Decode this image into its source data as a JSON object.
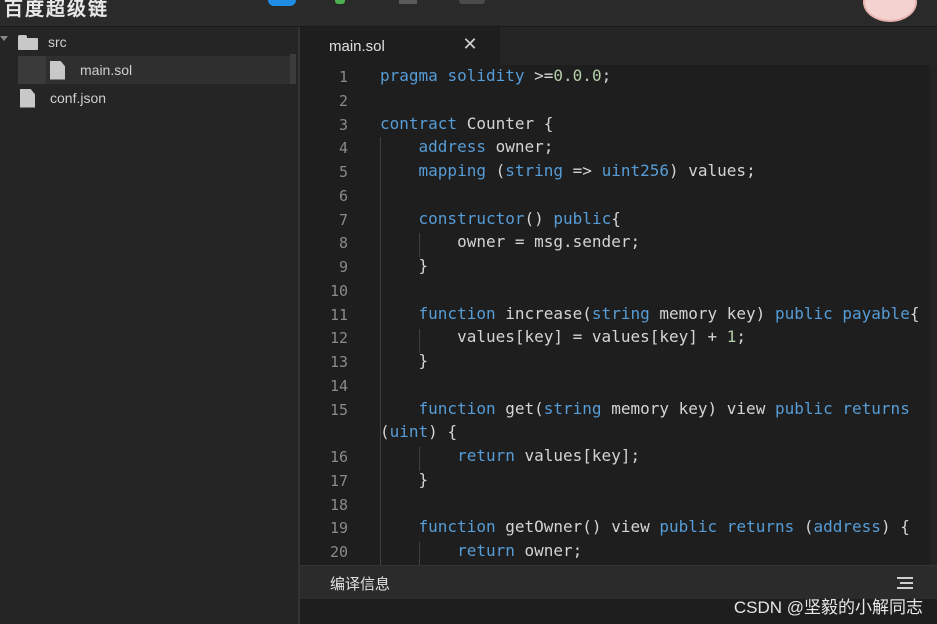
{
  "app": {
    "logo_text": "百度超级链"
  },
  "file_tree": {
    "items": [
      {
        "label": "src",
        "type": "folder"
      },
      {
        "label": "main.sol",
        "type": "file"
      },
      {
        "label": "conf.json",
        "type": "file"
      }
    ]
  },
  "editor": {
    "tab_label": "main.sol",
    "close_glyph": "✕"
  },
  "code_lines": [
    "1",
    "2",
    "3",
    "4",
    "5",
    "6",
    "7",
    "8",
    "9",
    "10",
    "11",
    "12",
    "13",
    "14",
    "15",
    "16",
    "17",
    "18",
    "19",
    "20"
  ],
  "panel": {
    "title": "编译信息"
  },
  "watermark": "CSDN @坚毅的小解同志",
  "colors": {
    "keyword": "#569cd6",
    "number": "#b5cea8",
    "text": "#d4d4d4",
    "accent": "#1f8ce6"
  }
}
